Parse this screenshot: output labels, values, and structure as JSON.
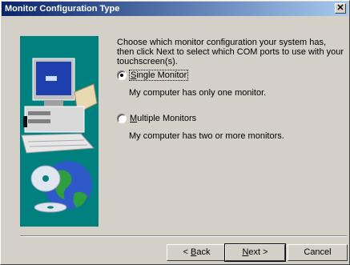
{
  "window": {
    "title": "Monitor Configuration Type",
    "close_glyph": "✕"
  },
  "description": "Choose which monitor configuration your system has, then click Next to select which COM ports to use with your touchscreen(s).",
  "options": [
    {
      "label_pre": "",
      "label_mnemonic": "S",
      "label_post": "ingle Monitor",
      "selected": true,
      "hint": "My computer has only one monitor."
    },
    {
      "label_pre": "",
      "label_mnemonic": "M",
      "label_post": "ultiple Monitors",
      "selected": false,
      "hint": "My computer has two or more monitors."
    }
  ],
  "buttons": {
    "back": {
      "pre": "< ",
      "mnemonic": "B",
      "post": "ack"
    },
    "next": {
      "pre": "",
      "mnemonic": "N",
      "post": "ext >"
    },
    "cancel": "Cancel"
  },
  "illustration": {
    "icons": [
      "computer-icon",
      "globe-icon",
      "cd-icon"
    ]
  }
}
